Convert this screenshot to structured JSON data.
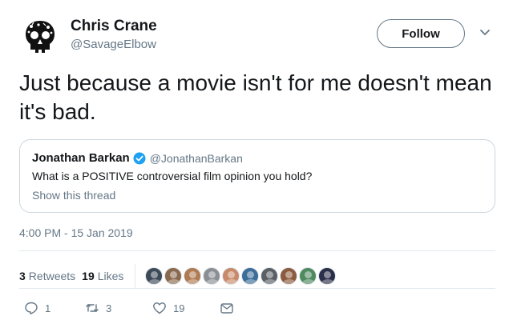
{
  "author": {
    "name": "Chris Crane",
    "handle": "@SavageElbow",
    "follow_label": "Follow"
  },
  "tweet": {
    "text": "Just because a movie isn't for me doesn't mean it's bad.",
    "timestamp": "4:00 PM - 15 Jan 2019"
  },
  "quoted": {
    "name": "Jonathan Barkan",
    "handle": "@JonathanBarkan",
    "text": "What is a POSITIVE controversial film opinion you hold?",
    "show_thread": "Show this thread"
  },
  "stats": {
    "retweets_count": "3",
    "retweets_label": "Retweets",
    "likes_count": "19",
    "likes_label": "Likes"
  },
  "likers": [
    {
      "color": "#3d4a57"
    },
    {
      "color": "#8a6a4f"
    },
    {
      "color": "#b07a52"
    },
    {
      "color": "#8b8f94"
    },
    {
      "color": "#c98a6b"
    },
    {
      "color": "#3e6d99"
    },
    {
      "color": "#5a6066"
    },
    {
      "color": "#8c5a3c"
    },
    {
      "color": "#4f8a5f"
    },
    {
      "color": "#2b2f4a"
    }
  ],
  "actions": {
    "reply_count": "1",
    "retweet_count": "3",
    "like_count": "19"
  },
  "colors": {
    "text": "#14171a",
    "secondary": "#657786",
    "border": "#e1e8ed",
    "verified": "#1da1f2"
  },
  "icons": {
    "verified": "verified-badge-icon",
    "chevron": "chevron-down-icon",
    "reply": "reply-icon",
    "retweet": "retweet-icon",
    "like": "heart-icon",
    "message": "direct-message-icon"
  }
}
